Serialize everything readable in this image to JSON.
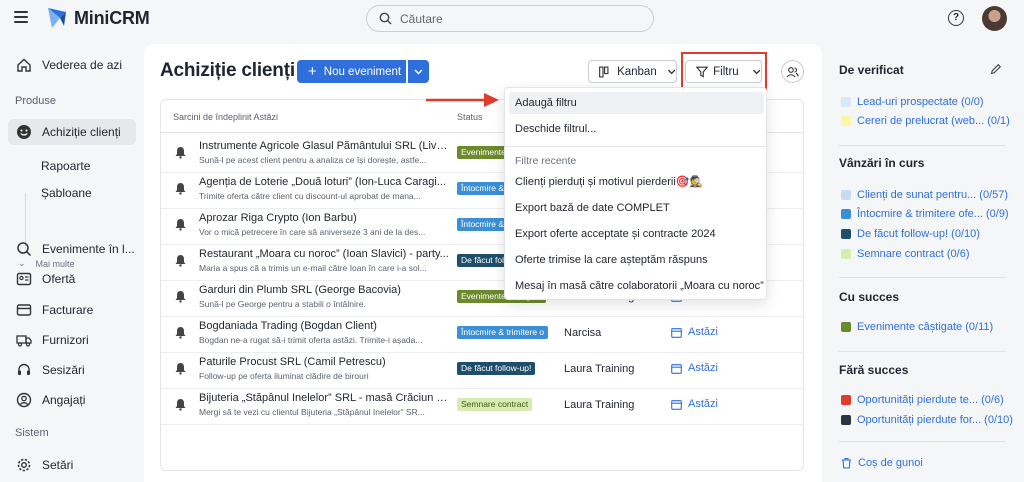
{
  "app": {
    "name": "MiniCRM"
  },
  "search": {
    "placeholder": "Căutare"
  },
  "sidebar": {
    "top_item": "Vederea de azi",
    "section_produse": "Produse",
    "active_item": "Achiziție clienți",
    "sub_items": [
      "Rapoarte",
      "Șabloane"
    ],
    "more_label": "Mai multe",
    "items": [
      "Evenimente în l...",
      "Ofertă",
      "Facturare",
      "Furnizori",
      "Sesizări",
      "Angajați"
    ],
    "section_sistem": "Sistem",
    "settings": "Setări"
  },
  "main": {
    "title": "Achiziție clienți",
    "new_event": "Nou eveniment",
    "kanban": "Kanban",
    "filter": "Filtru",
    "col_tasks": "Sarcini de îndeplinit Astăzi",
    "col_status": "Status"
  },
  "rows": [
    {
      "name": "Instrumente Agricole Glasul Pământului SRL (Liviu...",
      "desc": "Sună-l pe acest client pentru a analiza ce își dorește, astfe...",
      "badge": "Evenimente câștigate",
      "badge_bg": "#6b8a2a",
      "badge_fg": "#ffffff",
      "owner": "",
      "due": ""
    },
    {
      "name": "Agenția de Loterie „Două loturi” (Ion-Luca Caragi...",
      "desc": "Trimite oferta către client cu discount-ul aprobat de mana...",
      "badge": "Întocmire & trimitere",
      "badge_bg": "#3b8fd6",
      "badge_fg": "#ffffff",
      "owner": "",
      "due": ""
    },
    {
      "name": "Aprozar Riga Crypto (Ion Barbu)",
      "desc": "Vor o mică petrecere în care să aniverseze 3 ani de la des...",
      "badge": "Întocmire & trimitere",
      "badge_bg": "#3b8fd6",
      "badge_fg": "#ffffff",
      "owner": "",
      "due": ""
    },
    {
      "name": "Restaurant „Moara cu noroc” (Ioan Slavici) - party...",
      "desc": "Maria a spus că a trimis un e-mail către Ioan în care i-a sol...",
      "badge": "De făcut follow-up!",
      "badge_bg": "#1f4e6b",
      "badge_fg": "#ffffff",
      "owner": "",
      "due": ""
    },
    {
      "name": "Garduri din Plumb SRL (George Bacovia)",
      "desc": "Sună-l pe George pentru a stabili o întâlnire.",
      "badge": "Evenimente câștigate",
      "badge_bg": "#6b8a2a",
      "badge_fg": "#ffffff",
      "owner": "Laura Training",
      "due": "Astăzi"
    },
    {
      "name": "Bogdaniada Trading (Bogdan Client)",
      "desc": "Bogdan ne-a rugat să-i trimit oferta astăzi. Trimite-i așada...",
      "badge": "Întocmire & trimitere o",
      "badge_bg": "#3b8fd6",
      "badge_fg": "#ffffff",
      "owner": "Narcisa",
      "due": "Astăzi"
    },
    {
      "name": "Paturile Procust SRL (Camil Petrescu)",
      "desc": "Follow-up pe oferta iluminat clădire de birouri",
      "badge": "De făcut follow-up!",
      "badge_bg": "#1f4e6b",
      "badge_fg": "#ffffff",
      "owner": "Laura Training",
      "due": "Astăzi"
    },
    {
      "name": "Bijuteria „Stăpânul Inelelor” SRL - masă Crăciun 2...",
      "desc": "Mergi să te vezi cu clientul Bijuteria „Stăpânul Inelelor” SR...",
      "badge": "Semnare contract",
      "badge_bg": "#d6edb2",
      "badge_fg": "#3e5a15",
      "owner": "Laura Training",
      "due": "Astăzi"
    }
  ],
  "dropdown": {
    "add_filter": "Adaugă filtru",
    "open_filter": "Deschide filtrul...",
    "recent_label": "Filtre recente",
    "recent": [
      "Clienți pierduți și motivul pierderii🎯🕵️",
      "Export bază de date COMPLET",
      "Export oferte acceptate și contracte 2024",
      "Oferte trimise la care așteptăm răspuns",
      "Mesaj în masă către colaboratorii „Moara cu noroc”"
    ]
  },
  "right": {
    "s1_title": "De verificat",
    "s1": [
      {
        "label": "Lead-uri prospectate (0/0)",
        "color": "#dbe9f7"
      },
      {
        "label": "Cereri de prelucrat (web... (0/1)",
        "color": "#fbf6a8"
      }
    ],
    "s2_title": "Vânzări în curs",
    "s2": [
      {
        "label": "Clienți de sunat pentru... (0/57)",
        "color": "#c7dcf2"
      },
      {
        "label": "Întocmire & trimitere ofe... (0/9)",
        "color": "#3b8fd6"
      },
      {
        "label": "De făcut follow-up! (0/10)",
        "color": "#1f4e6b"
      },
      {
        "label": "Semnare contract (0/6)",
        "color": "#d6edb2"
      }
    ],
    "s3_title": "Cu succes",
    "s3": [
      {
        "label": "Evenimente câștigate (0/11)",
        "color": "#6b8a2a"
      }
    ],
    "s4_title": "Fără succes",
    "s4": [
      {
        "label": "Oportunități pierdute te... (0/6)",
        "color": "#e13b2b"
      },
      {
        "label": "Oportunități pierdute for... (0/10)",
        "color": "#2a3442"
      }
    ],
    "trash": "Coș de gunoi"
  }
}
